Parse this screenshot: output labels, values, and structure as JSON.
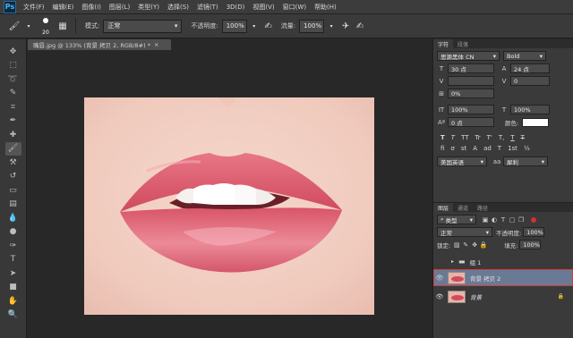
{
  "app": {
    "logo": "Ps"
  },
  "menu": [
    "文件(F)",
    "编辑(E)",
    "图像(I)",
    "图层(L)",
    "类型(Y)",
    "选择(S)",
    "滤镜(T)",
    "3D(D)",
    "视图(V)",
    "窗口(W)",
    "帮助(H)"
  ],
  "options": {
    "brush_size": "20",
    "mode_label": "模式:",
    "mode_value": "正常",
    "opacity_label": "不透明度:",
    "opacity_value": "100%",
    "flow_label": "流量:",
    "flow_value": "100%"
  },
  "document": {
    "tab_title": "嘴唇.jpg @ 133% (背景 拷贝 2, RGB/8#) *"
  },
  "character_panel": {
    "tabs": [
      "字符",
      "段落"
    ],
    "font_family": "思源黑体 CN",
    "font_style": "Bold",
    "font_size": "30 点",
    "leading": "24 点",
    "kerning": "",
    "tracking": "0",
    "tsume": "0%",
    "vertical_scale": "100%",
    "horizontal_scale": "100%",
    "baseline_shift": "0 点",
    "color_label": "颜色:",
    "language": "美国英语",
    "antialias": "犀利",
    "style_buttons": [
      "T",
      "T",
      "TT",
      "Tr",
      "T'",
      "T,",
      "T",
      "T"
    ],
    "feature_buttons": [
      "fi",
      "σ",
      "st",
      "A",
      "ad",
      "T",
      "1st",
      "½"
    ],
    "colors": {
      "text_color": "#ffffff"
    }
  },
  "layers_panel": {
    "tabs": [
      "图层",
      "通道",
      "路径"
    ],
    "filter_kind": "类型",
    "blend_mode": "正常",
    "opacity_label": "不透明度:",
    "opacity_value": "100%",
    "lock_label": "锁定:",
    "fill_label": "填充:",
    "fill_value": "100%",
    "layers": [
      {
        "name": "组 1",
        "type": "group",
        "selected": false
      },
      {
        "name": "背景 拷贝 2",
        "type": "pixel",
        "selected": true
      },
      {
        "name": "背景",
        "type": "pixel",
        "selected": false,
        "locked": true
      }
    ],
    "colors": {
      "selected_bg": "#6b7a94",
      "selected_outline": "#d23a3a"
    }
  }
}
